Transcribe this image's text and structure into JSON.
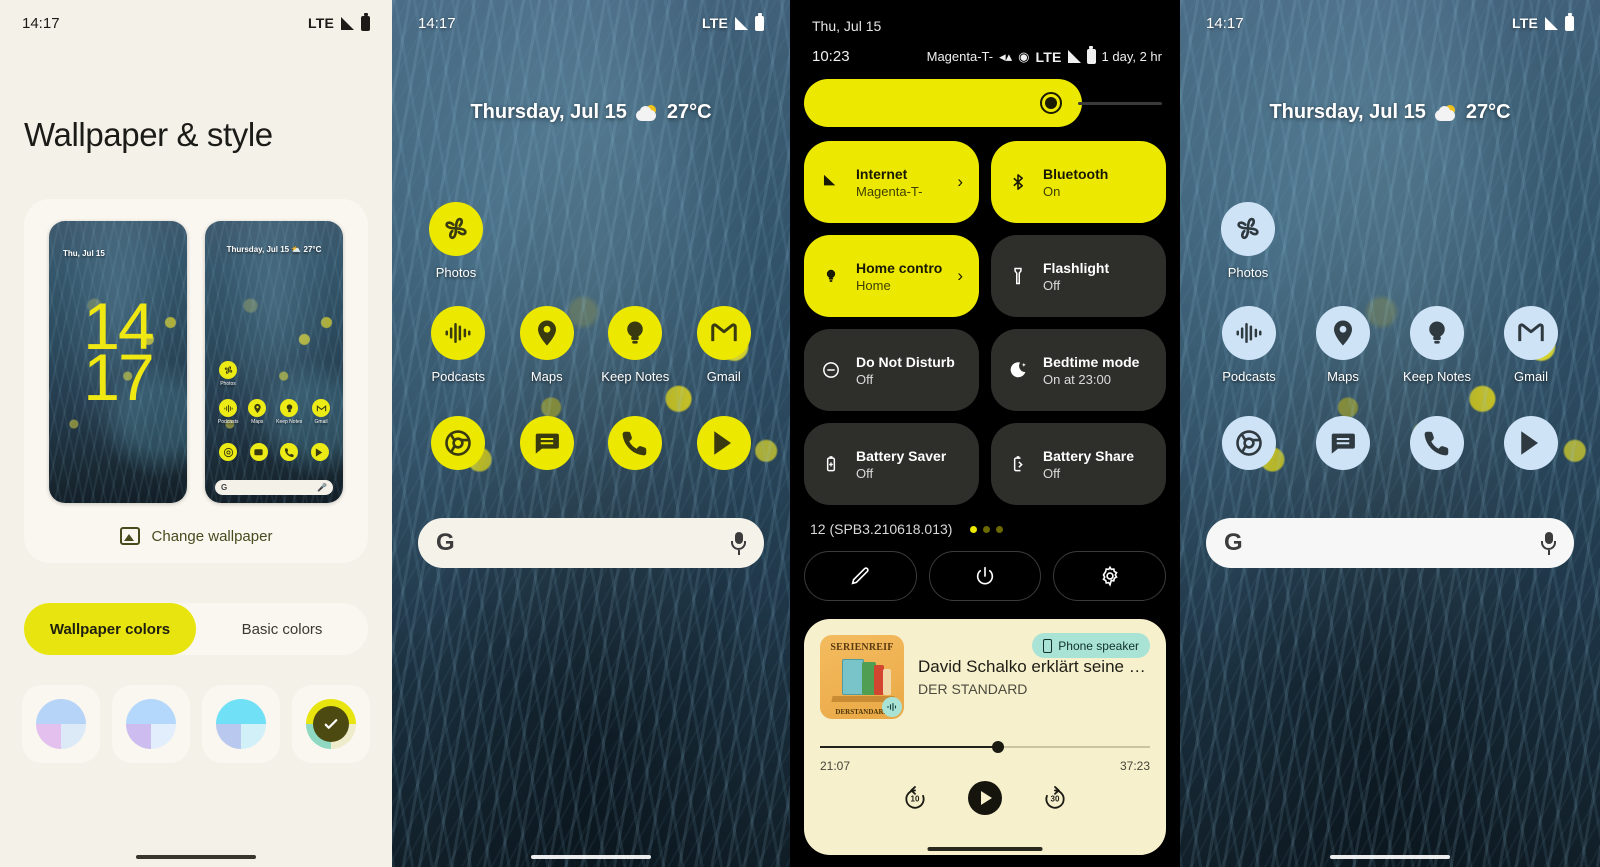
{
  "panel1": {
    "status": {
      "time": "14:17",
      "network": "LTE"
    },
    "page_title": "Wallpaper & style",
    "preview_lock": {
      "date": "Thu, Jul 15",
      "clock_hours": "14",
      "clock_minutes": "17"
    },
    "preview_home": {
      "date": "Thursday, Jul 15  ⛅ 27°C",
      "row1": [
        "Photos"
      ],
      "row2": [
        "Podcasts",
        "Maps",
        "Keep Notes",
        "Gmail"
      ],
      "search_logo": "G"
    },
    "change_wallpaper": "Change wallpaper",
    "tabs": [
      {
        "label": "Wallpaper colors",
        "active": true
      },
      {
        "label": "Basic colors",
        "active": false
      }
    ],
    "swatches": [
      {
        "name": "swatch-1",
        "selected": false,
        "colors": [
          "#b6d4f7",
          "#b6d4f7",
          "#e4c0ee",
          "#dceaf8"
        ]
      },
      {
        "name": "swatch-2",
        "selected": false,
        "colors": [
          "#b3d8fb",
          "#b3d8fb",
          "#cdbcef",
          "#e2eefb"
        ]
      },
      {
        "name": "swatch-3",
        "selected": false,
        "colors": [
          "#6fe0f5",
          "#6fe0f5",
          "#b9c8ee",
          "#d2f0f8"
        ]
      },
      {
        "name": "swatch-4",
        "selected": true,
        "colors": [
          "#e8e40f",
          "#e8e40f",
          "#8fd9c2",
          "#eeeccb"
        ]
      }
    ]
  },
  "panel2": {
    "status": {
      "time": "14:17",
      "network": "LTE"
    },
    "weather": {
      "date": "Thursday, Jul 15",
      "temp": "27°C"
    },
    "apps_row1": [
      {
        "label": "Photos",
        "icon": "photos-icon"
      }
    ],
    "apps_row2": [
      {
        "label": "Podcasts",
        "icon": "podcasts-icon"
      },
      {
        "label": "Maps",
        "icon": "maps-icon"
      },
      {
        "label": "Keep Notes",
        "icon": "keep-notes-icon"
      },
      {
        "label": "Gmail",
        "icon": "gmail-icon"
      }
    ],
    "dock": [
      {
        "label": "Chrome",
        "icon": "chrome-icon"
      },
      {
        "label": "Messages",
        "icon": "messages-icon"
      },
      {
        "label": "Phone",
        "icon": "phone-icon"
      },
      {
        "label": "Play Store",
        "icon": "play-store-icon"
      }
    ],
    "search": {
      "logo": "G",
      "mic": "mic-icon"
    },
    "accent": "#ece800",
    "icon_fg": "#3a3a10"
  },
  "panel3": {
    "date": "Thu, Jul 15",
    "status": {
      "time": "10:23",
      "carrier": "Magenta-T-",
      "network": "LTE",
      "battery": "1 day, 2 hr"
    },
    "brightness": {
      "label": "brightness-slider",
      "value_pct": 72
    },
    "tiles": [
      {
        "title": "Internet",
        "sub": "Magenta-T-",
        "state": "on",
        "icon": "signal-icon",
        "chevron": "›"
      },
      {
        "title": "Bluetooth",
        "sub": "On",
        "state": "on",
        "icon": "bluetooth-icon",
        "chevron": ""
      },
      {
        "title": "Home contro",
        "sub": "Home",
        "state": "on",
        "icon": "home-control-icon",
        "chevron": "›"
      },
      {
        "title": "Flashlight",
        "sub": "Off",
        "state": "off",
        "icon": "flashlight-icon",
        "chevron": ""
      },
      {
        "title": "Do Not Disturb",
        "sub": "Off",
        "state": "off",
        "icon": "dnd-icon",
        "chevron": ""
      },
      {
        "title": "Bedtime mode",
        "sub": "On at 23:00",
        "state": "off",
        "icon": "bedtime-icon",
        "chevron": ""
      },
      {
        "title": "Battery Saver",
        "sub": "Off",
        "state": "off",
        "icon": "battery-saver-icon",
        "chevron": ""
      },
      {
        "title": "Battery Share",
        "sub": "Off",
        "state": "off",
        "icon": "battery-share-icon",
        "chevron": ""
      }
    ],
    "build": "12 (SPB3.210618.013)",
    "page_dots": {
      "count": 3,
      "active_index": 0
    },
    "actions": [
      {
        "name": "edit-button",
        "icon": "pencil-icon"
      },
      {
        "name": "power-button",
        "icon": "power-icon"
      },
      {
        "name": "settings-button",
        "icon": "gear-icon"
      }
    ],
    "media": {
      "output_chip": "Phone speaker",
      "album_title": "SERIENREIF",
      "album_publisher": "DERSTANDARD",
      "title": "David Schalko erklärt seine S…",
      "subtitle": "DER STANDARD",
      "elapsed": "21:07",
      "remaining": "37:23",
      "progress_pct": 54,
      "controls": [
        {
          "name": "rewind-10-button",
          "label": "10"
        },
        {
          "name": "play-button",
          "label": ""
        },
        {
          "name": "forward-30-button",
          "label": "30"
        }
      ]
    },
    "accent": "#ece800"
  },
  "panel4": {
    "status": {
      "time": "14:17",
      "network": "LTE"
    },
    "weather": {
      "date": "Thursday, Jul 15",
      "temp": "27°C"
    },
    "apps_row1": [
      {
        "label": "Photos",
        "icon": "photos-icon"
      }
    ],
    "apps_row2": [
      {
        "label": "Podcasts",
        "icon": "podcasts-icon"
      },
      {
        "label": "Maps",
        "icon": "maps-icon"
      },
      {
        "label": "Keep Notes",
        "icon": "keep-notes-icon"
      },
      {
        "label": "Gmail",
        "icon": "gmail-icon"
      }
    ],
    "dock": [
      {
        "label": "Chrome",
        "icon": "chrome-icon"
      },
      {
        "label": "Messages",
        "icon": "messages-icon"
      },
      {
        "label": "Phone",
        "icon": "phone-icon"
      },
      {
        "label": "Play Store",
        "icon": "play-store-icon"
      }
    ],
    "search": {
      "logo": "G",
      "mic": "mic-icon"
    },
    "accent": "#cfe3f7",
    "icon_fg": "#2f3a40"
  }
}
